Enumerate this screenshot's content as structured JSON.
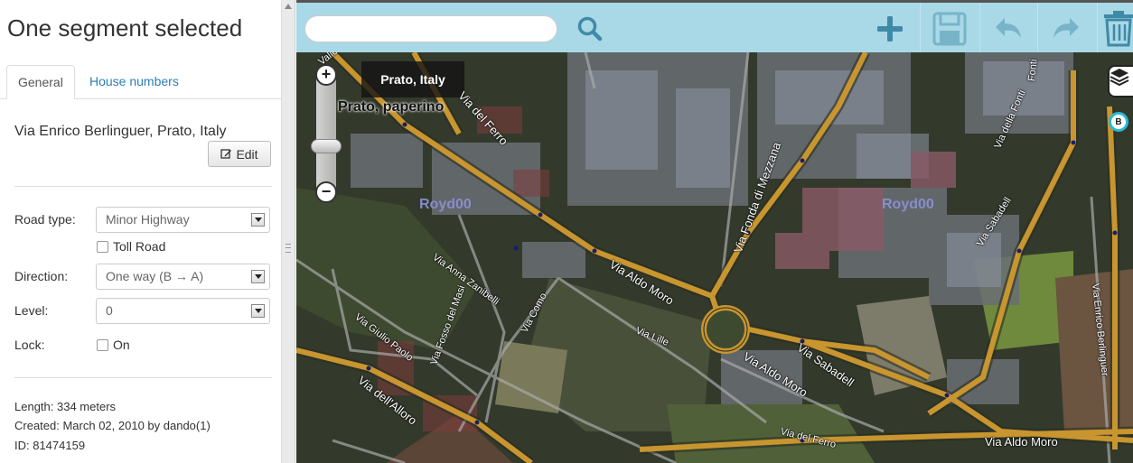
{
  "panel": {
    "title": "One segment selected",
    "tabs": [
      {
        "label": "General",
        "active": true
      },
      {
        "label": "House numbers",
        "active": false
      }
    ],
    "street_name": "Via Enrico Berlinguer, Prato, Italy",
    "edit_label": "Edit",
    "fields": {
      "road_type": {
        "label": "Road type:",
        "value": "Minor Highway"
      },
      "toll_road": {
        "label": "Toll Road",
        "checked": false
      },
      "direction": {
        "label": "Direction:",
        "value": "One way (B → A)"
      },
      "level": {
        "label": "Level:",
        "value": "0"
      },
      "lock": {
        "label": "Lock:",
        "option_label": "On",
        "checked": false
      }
    },
    "info": {
      "length": "Length: 334 meters",
      "created": "Created: March 02, 2010 by dando(1)",
      "id": "ID: 81474159"
    }
  },
  "toolbar": {
    "search_placeholder": "",
    "icons": [
      "search-icon",
      "add-icon",
      "save-icon",
      "undo-icon",
      "redo-icon",
      "delete-icon"
    ],
    "accent": "#a9d8e6"
  },
  "map": {
    "location_chip": "Prato, Italy",
    "location_overlay": "Prato, paperino",
    "area_labels": [
      "Royd00",
      "Royd00"
    ],
    "road_labels": [
      "Vallo",
      "Via del Ferro",
      "Via Fonda di Mezzana",
      "Via Aldo Moro",
      "Via Sabadell",
      "Via Enrico Berlinguer",
      "Via dell'Alloro",
      "Via Giulio Paolo",
      "Via Fosso del Masi",
      "Via Como",
      "Via Lille",
      "Via Anna Zanibelli",
      "Via Aldo Moro",
      "Via Aldo Moro",
      "Via Sabadell",
      "Via della Fonti",
      "Fonti",
      "Via del Ferro"
    ],
    "marker": "B",
    "segment_color": "#d8a53a"
  }
}
